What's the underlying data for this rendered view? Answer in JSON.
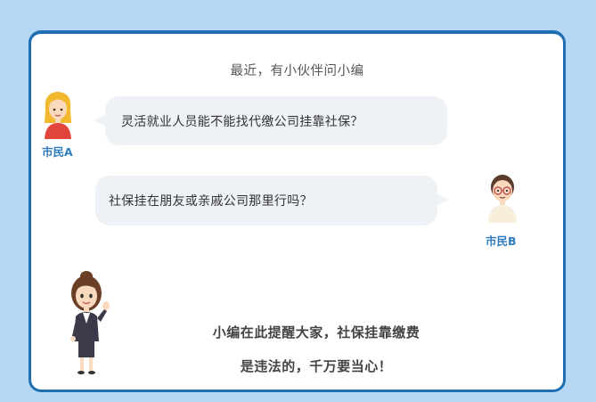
{
  "intro": "最近，有小伙伴问小编",
  "conversation": [
    {
      "speaker": "市民A",
      "text": "灵活就业人员能不能找代缴公司挂靠社保？"
    },
    {
      "speaker": "市民B",
      "text": "社保挂在朋友或亲戚公司那里行吗？"
    }
  ],
  "reminder": {
    "line1": "小编在此提醒大家，社保挂靠缴费",
    "line2": "是违法的，千万要当心！"
  },
  "colors": {
    "background": "#b5d7f3",
    "card_border": "#1f6fb2",
    "bubble": "#eef1f5",
    "name_tag": "#2f7cc0"
  }
}
